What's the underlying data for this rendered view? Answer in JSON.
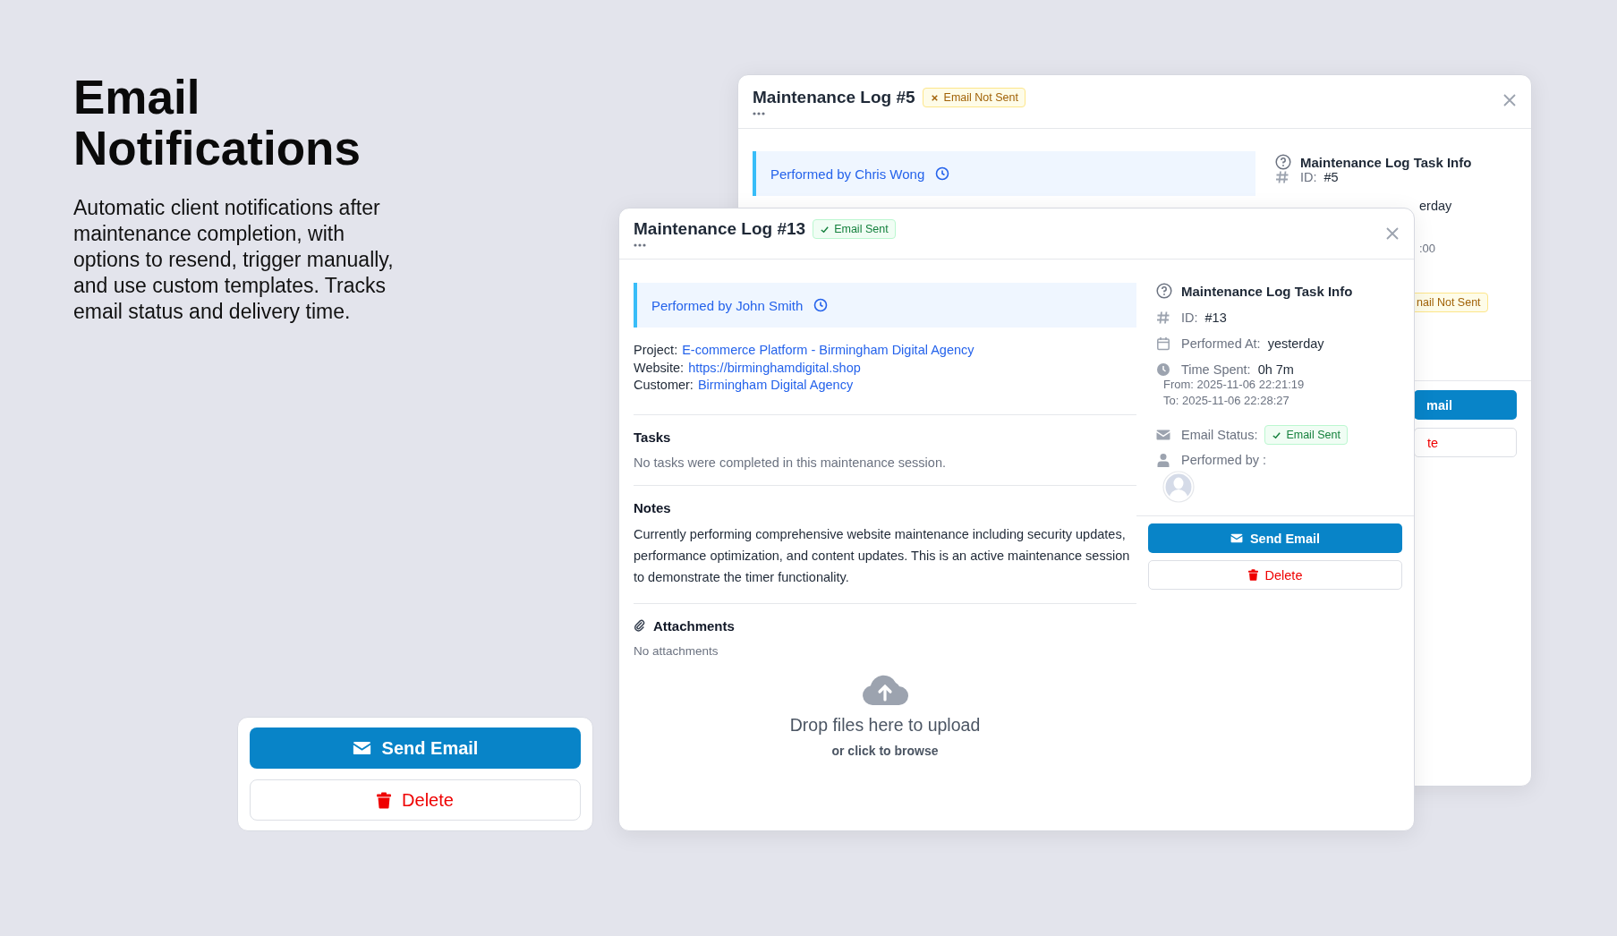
{
  "hero": {
    "title": "Email Notifications",
    "description": "Automatic client notifications after maintenance completion, with options to resend, trigger manually, and use custom templates. Tracks email status and delivery time."
  },
  "button_card": {
    "buttons": [
      {
        "kind": "send",
        "label": "Send Email"
      },
      {
        "kind": "delete",
        "label": "Delete"
      }
    ]
  },
  "back_window": {
    "title": "Maintenance Log #5",
    "status_badge": {
      "kind": "not_sent",
      "label": "Email Not Sent"
    },
    "performed_by": {
      "label": "Performed by",
      "name": "Chris Wong"
    },
    "task_info": {
      "title": "Maintenance Log Task Info",
      "id_label": "ID:",
      "id_value": "#5",
      "performed_at_fragment": "erday",
      "time_fragment": ":00",
      "email_badge": {
        "kind": "not_sent",
        "label": "nail Not Sent"
      }
    },
    "buttons": [
      {
        "kind": "send",
        "label": "mail"
      },
      {
        "kind": "delete",
        "label": "te"
      }
    ]
  },
  "front_window": {
    "title": "Maintenance Log #13",
    "status_badge": {
      "kind": "sent",
      "label": "Email Sent"
    },
    "performed_by": {
      "label": "Performed by",
      "name": "John Smith"
    },
    "details": [
      {
        "label": "Project:",
        "value": "E-commerce Platform - Birmingham Digital Agency"
      },
      {
        "label": "Website:",
        "value": "https://birminghamdigital.shop"
      },
      {
        "label": "Customer:",
        "value": "Birmingham Digital Agency"
      }
    ],
    "tasks": {
      "heading": "Tasks",
      "text": "No tasks were completed in this maintenance session."
    },
    "notes": {
      "heading": "Notes",
      "text": "Currently performing comprehensive website maintenance including security updates, performance optimization, and content updates. This is an active maintenance session to demonstrate the timer functionality."
    },
    "attachments": {
      "heading": "Attachments",
      "empty_text": "No attachments",
      "dropzone": {
        "title": "Drop files here to upload",
        "hint": "or click to browse"
      }
    },
    "task_info": {
      "title": "Maintenance Log Task Info",
      "rows": [
        {
          "kind": "id",
          "label": "ID:",
          "value": "#13"
        },
        {
          "kind": "date",
          "label": "Performed At:",
          "value": "yesterday"
        },
        {
          "kind": "time",
          "label": "Time Spent:",
          "value": "0h 7m",
          "from": "From: 2025-11-06 22:21:19",
          "to": "To: 2025-11-06 22:28:27"
        },
        {
          "kind": "email",
          "label": "Email Status:",
          "badge": {
            "kind": "sent",
            "label": "Email Sent"
          }
        },
        {
          "kind": "user",
          "label": "Performed by :"
        }
      ]
    },
    "buttons": [
      {
        "kind": "send",
        "label": "Send Email"
      },
      {
        "kind": "delete",
        "label": "Delete"
      }
    ]
  }
}
